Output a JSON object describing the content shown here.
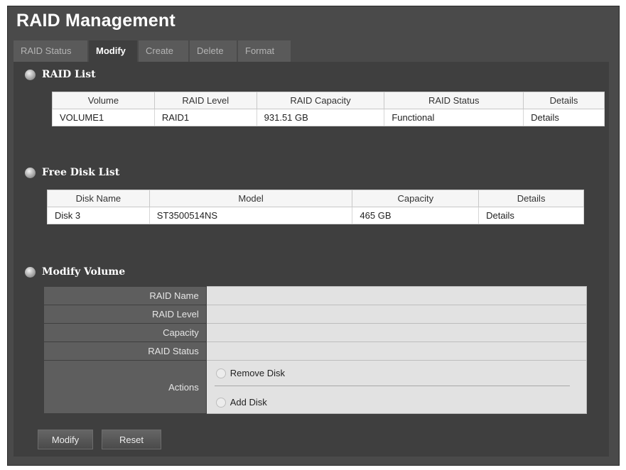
{
  "title": "RAID Management",
  "tabs": [
    "RAID Status",
    "Modify",
    "Create",
    "Delete",
    "Format"
  ],
  "active_tab": "Modify",
  "raid_list": {
    "heading": "RAID List",
    "columns": [
      "Volume",
      "RAID Level",
      "RAID Capacity",
      "RAID Status",
      "Details"
    ],
    "rows": [
      [
        "VOLUME1",
        "RAID1",
        "931.51 GB",
        "Functional",
        "Details"
      ]
    ]
  },
  "free_disk_list": {
    "heading": "Free Disk List",
    "columns": [
      "Disk Name",
      "Model",
      "Capacity",
      "Details"
    ],
    "rows": [
      [
        "Disk 3",
        "ST3500514NS",
        "465 GB",
        "Details"
      ]
    ]
  },
  "modify_volume": {
    "heading": "Modify Volume",
    "fields": [
      "RAID Name",
      "RAID Level",
      "Capacity",
      "RAID Status"
    ],
    "actions_label": "Actions",
    "options": [
      "Remove Disk",
      "Add Disk"
    ]
  },
  "buttons": {
    "modify": "Modify",
    "reset": "Reset"
  }
}
